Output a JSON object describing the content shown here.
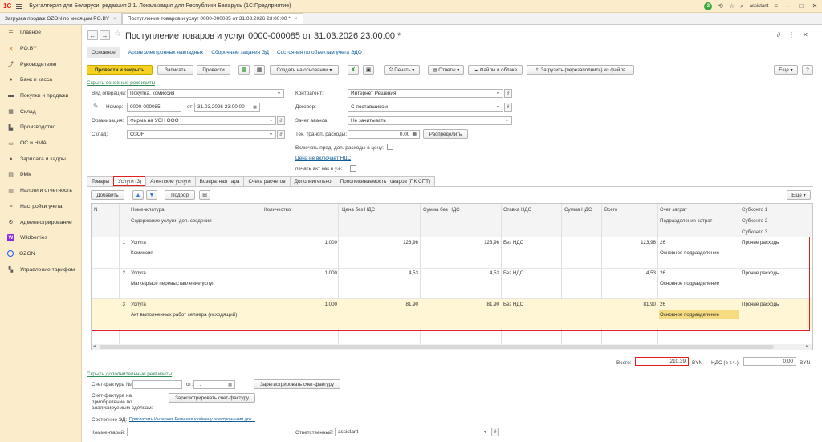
{
  "titlebar": {
    "logo": "1С",
    "title": "Бухгалтерия для Беларуси, редакция 2.1. Локализация для Республики Беларусь   (1С:Предприятие)",
    "notif_count": "2",
    "user": "assistant"
  },
  "tabs": [
    {
      "label": "Загрузка продаж OZON по месяцам PO.BY",
      "close": "×"
    },
    {
      "label": "Поступление товаров и услуг 0000-000085 от 31.03.2026 23:00:00 *",
      "close": "×"
    }
  ],
  "sidebar": {
    "items": [
      {
        "label": "Главное",
        "icon": "menu-icon"
      },
      {
        "label": "PO.BY",
        "icon": "cross-icon"
      },
      {
        "label": "Руководителю",
        "icon": "chart-icon"
      },
      {
        "label": "Банк и касса",
        "icon": "bank-icon"
      },
      {
        "label": "Покупки и продажи",
        "icon": "cart-icon"
      },
      {
        "label": "Склад",
        "icon": "warehouse-icon"
      },
      {
        "label": "Производство",
        "icon": "factory-icon"
      },
      {
        "label": "ОС и НМА",
        "icon": "car-icon"
      },
      {
        "label": "Зарплата и кадры",
        "icon": "people-icon"
      },
      {
        "label": "РМК",
        "icon": "register-icon"
      },
      {
        "label": "Налоги и отчетность",
        "icon": "tax-icon"
      },
      {
        "label": "Настройки учета",
        "icon": "settings-icon"
      },
      {
        "label": "Администрирование",
        "icon": "gear-icon"
      },
      {
        "label": "Wildberries",
        "icon": "wb-icon",
        "glyph": "W"
      },
      {
        "label": "OZON",
        "icon": "ozon-icon"
      },
      {
        "label": "Управление тарифом",
        "icon": "tariff-icon"
      }
    ]
  },
  "doc": {
    "title": "Поступление товаров и услуг 0000-000085 от 31.03.2026 23:00:00 *",
    "links": [
      "Основное",
      "Архив электронных накладных",
      "Сборочные задания ЭД",
      "Состояния по объектам учета ЭДО"
    ]
  },
  "toolbar": {
    "post_close": "Провести и закрыть",
    "save": "Записать",
    "post": "Провести",
    "create_based": "Создать на основании",
    "print": "Печать",
    "reports": "Отчеты",
    "files_cloud": "Файлы в облаке",
    "load_file": "Загрузить (перезаполнить) из файла",
    "more": "Еще",
    "help": "?"
  },
  "form": {
    "hide_main": "Скрыть основные реквизиты",
    "op_type_label": "Вид операции:",
    "op_type": "Покупка, комиссия",
    "number_label": "Номер:",
    "number": "0000-000085",
    "date_label": "от:",
    "date": "31.03.2026 23:00:00",
    "org_label": "Организация:",
    "org": "Фирма на УСН ООО",
    "warehouse_label": "Склад:",
    "warehouse": "ОЗОН",
    "contractor_label": "Контрагент:",
    "contractor": "Интернет Решения",
    "contract_label": "Договор:",
    "contract": "С поставщиком",
    "advance_label": "Зачет аванса:",
    "advance": "Не зачитывать",
    "transport_label": "Тек. трансп. расходы:",
    "transport": "0,00",
    "distribute": "Распределить",
    "include_prev": "Включать пред. доп. расходы в цену:",
    "price_vat_link": "Цена не включает НДС",
    "print_act": "печать акт как в у.е:"
  },
  "subtabs": [
    "Товары",
    "Услуги (3)",
    "Агентские услуги",
    "Возвратная тара",
    "Счета расчетов",
    "Дополнительно",
    "Прослеживаемость товаров (ПК СПТ)"
  ],
  "grid": {
    "add": "Добавить",
    "pick": "Подбор",
    "more": "Еще",
    "headers": {
      "n": "N",
      "item": "Номенклатура",
      "item_sub": "Содержание услуги, доп. сведения",
      "qty": "Количество",
      "price": "Цена без НДС",
      "sum": "Сумма без НДС",
      "vat_rate": "Ставка НДС",
      "vat_sum": "Сумма НДС",
      "total": "Всего",
      "account": "Счет затрат",
      "dept": "Подразделение затрат",
      "sub1": "Субконто 1",
      "sub2": "Субконто 2",
      "sub3": "Субконто 3"
    },
    "rows": [
      {
        "n": "1",
        "item": "Услуга",
        "content": "Комиссия",
        "qty": "1,000",
        "price": "123,96",
        "sum": "123,96",
        "vat_rate": "Без НДС",
        "vat_sum": "",
        "total": "123,96",
        "account": "26",
        "dept": "Основное подразделение",
        "sub1": "Прочие расходы"
      },
      {
        "n": "2",
        "item": "Услуга",
        "content": "Marketplace перевыставление услуг",
        "qty": "1,000",
        "price": "4,53",
        "sum": "4,53",
        "vat_rate": "Без НДС",
        "vat_sum": "",
        "total": "4,53",
        "account": "26",
        "dept": "Основное подразделение",
        "sub1": "Прочие расходы"
      },
      {
        "n": "3",
        "item": "Услуга",
        "content": "Акт выполненных работ селлера (исходящий)",
        "qty": "1,000",
        "price": "81,90",
        "sum": "81,90",
        "vat_rate": "Без НДС",
        "vat_sum": "",
        "total": "81,90",
        "account": "26",
        "dept": "Основное подразделение",
        "sub1": "Прочие расходы"
      }
    ]
  },
  "totals": {
    "total_label": "Всего:",
    "total": "210,39",
    "currency": "BYN",
    "vat_label": "НДС (в т.ч.):",
    "vat": "0,00",
    "vat_currency": "BYN"
  },
  "footer": {
    "hide_extra": "Скрыть дополнительные реквизиты",
    "invoice_label": "Счет-фактура №",
    "invoice_date_label": "от:",
    "invoice_date": ". .",
    "register_invoice": "Зарегистрировать счет-фактуру",
    "invoice_purchase_label": "Счет-фактура на приобретение по анализируемым сделкам:",
    "register_invoice2": "Зарегистрировать счет-фактуру",
    "edo_label": "Состояние ЭД:",
    "edo_link": "Пригласить Интернет Решения к обмену электронными док...",
    "comment_label": "Комментарий:",
    "responsible_label": "Ответственный:",
    "responsible": "assistant"
  },
  "colors": {
    "accent_yellow": "#f5d21f",
    "sidebar_bg": "#fbeccb",
    "highlight": "#e02020",
    "row_sel": "#fff6d6"
  }
}
